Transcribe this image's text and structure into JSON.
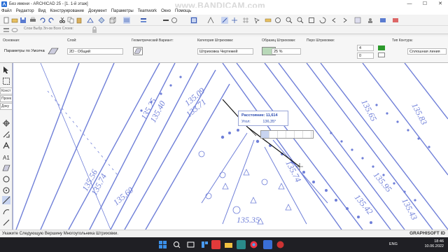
{
  "window": {
    "title": "Без имени - ARCHICAD 25 - [1. 1-й этаж]",
    "watermark": "www.BANDICAM.com",
    "controls": [
      "—",
      "☐",
      "✕"
    ]
  },
  "menu": [
    "Файл",
    "Редактор",
    "Вид",
    "Конструирование",
    "Документ",
    "Параметры",
    "Teamwork",
    "Окно",
    "Помощь"
  ],
  "layer_buttons": "Слои Выбр.Эл-ов Всех Слоев:",
  "infobox": {
    "main_label": "Основная:",
    "main_value": "Параметры по Умолчанию",
    "layer_label": "Слой:",
    "layer_value": "2D - Общий",
    "geometry_label": "Геометрический Вариант:",
    "hatch_cat_label": "Категория Штриховки:",
    "hatch_cat_value": "Штриховка Чертежей",
    "pattern_label": "Образец Штриховки:",
    "pattern_value": "25 %",
    "pen_label": "Перо Штриховки:",
    "pen_fg": "4",
    "pen_bg": "0",
    "contour_label": "Тип Контура:",
    "contour_value": "Сплошная линия"
  },
  "navtabs": [
    "Конст",
    "Проек",
    "Доку"
  ],
  "tooltip": {
    "distance_label": "Расстояние:",
    "distance_value": "11,614",
    "angle_label": "Угол:",
    "angle_value": "136,35°"
  },
  "drawing_labels": {
    "l1": "135.25",
    "l2": "135.40",
    "l3": "135.09",
    "l4": "133.71",
    "l5": "135.56",
    "l6": "135.74",
    "l7": "135.60",
    "l8": "135.83",
    "l9": "135.65",
    "l10": "135.74",
    "l11": "135.42",
    "l12": "135.95",
    "l13": "135.43",
    "l14": "135.35"
  },
  "statusbar": {
    "text": "Укажите Следующую Вершину Многоугольника Штриховки.",
    "brand": "GRAPHISOFT ID"
  },
  "taskbar": {
    "lang": "ENG",
    "time": "18:46",
    "date": "10.06.2022"
  },
  "colors": {
    "drawing_blue": "#6f7fd8",
    "selection_black": "#111111",
    "taskbar": "#1f1f24"
  }
}
